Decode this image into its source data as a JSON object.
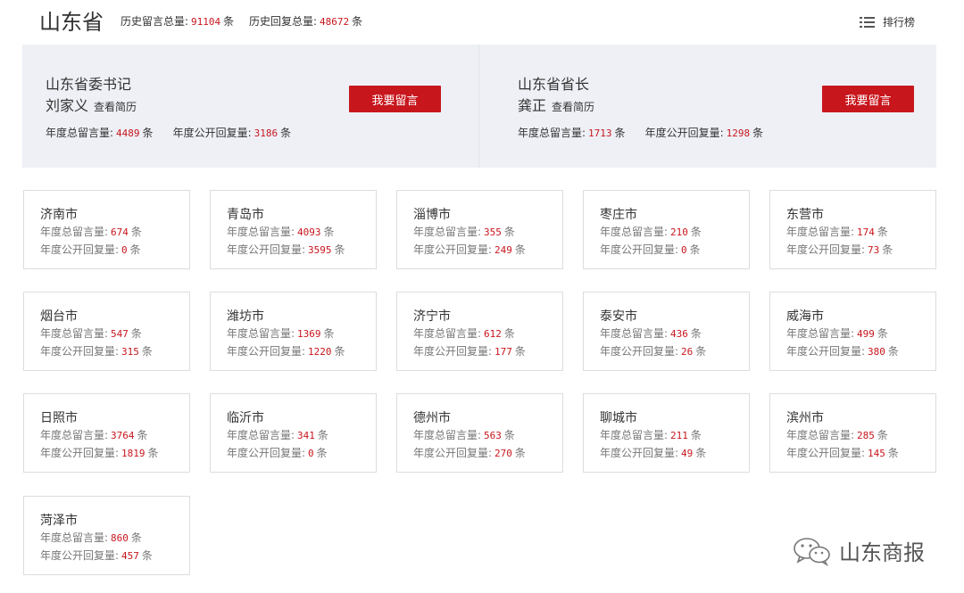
{
  "header": {
    "title": "山东省",
    "history_messages_label": "历史留言总量:",
    "history_messages_value": "91104",
    "history_replies_label": "历史回复总量:",
    "history_replies_value": "48672",
    "unit": "条",
    "ranking_label": "排行榜"
  },
  "leaders": [
    {
      "title": "山东省委书记",
      "name": "刘家义",
      "resume_link": "查看简历",
      "button_label": "我要留言",
      "messages_label": "年度总留言量:",
      "messages_value": "4489",
      "replies_label": "年度公开回复量:",
      "replies_value": "3186",
      "unit": "条"
    },
    {
      "title": "山东省省长",
      "name": "龚正",
      "resume_link": "查看简历",
      "button_label": "我要留言",
      "messages_label": "年度总留言量:",
      "messages_value": "1713",
      "replies_label": "年度公开回复量:",
      "replies_value": "1298",
      "unit": "条"
    }
  ],
  "city_labels": {
    "messages_label": "年度总留言量:",
    "replies_label": "年度公开回复量:",
    "unit": "条"
  },
  "cities": [
    {
      "name": "济南市",
      "messages": "674",
      "replies": "0"
    },
    {
      "name": "青岛市",
      "messages": "4093",
      "replies": "3595"
    },
    {
      "name": "淄博市",
      "messages": "355",
      "replies": "249"
    },
    {
      "name": "枣庄市",
      "messages": "210",
      "replies": "0"
    },
    {
      "name": "东营市",
      "messages": "174",
      "replies": "73"
    },
    {
      "name": "烟台市",
      "messages": "547",
      "replies": "315"
    },
    {
      "name": "潍坊市",
      "messages": "1369",
      "replies": "1220"
    },
    {
      "name": "济宁市",
      "messages": "612",
      "replies": "177"
    },
    {
      "name": "泰安市",
      "messages": "436",
      "replies": "26"
    },
    {
      "name": "威海市",
      "messages": "499",
      "replies": "380"
    },
    {
      "name": "日照市",
      "messages": "3764",
      "replies": "1819"
    },
    {
      "name": "临沂市",
      "messages": "341",
      "replies": "0"
    },
    {
      "name": "德州市",
      "messages": "563",
      "replies": "270"
    },
    {
      "name": "聊城市",
      "messages": "211",
      "replies": "49"
    },
    {
      "name": "滨州市",
      "messages": "285",
      "replies": "145"
    },
    {
      "name": "菏泽市",
      "messages": "860",
      "replies": "457"
    }
  ],
  "watermark": {
    "text": "山东商报",
    "icon": "wechat-icon"
  },
  "colors": {
    "accent": "#c8161d",
    "panel_bg": "#eef0f6",
    "card_border": "#dddddd"
  }
}
